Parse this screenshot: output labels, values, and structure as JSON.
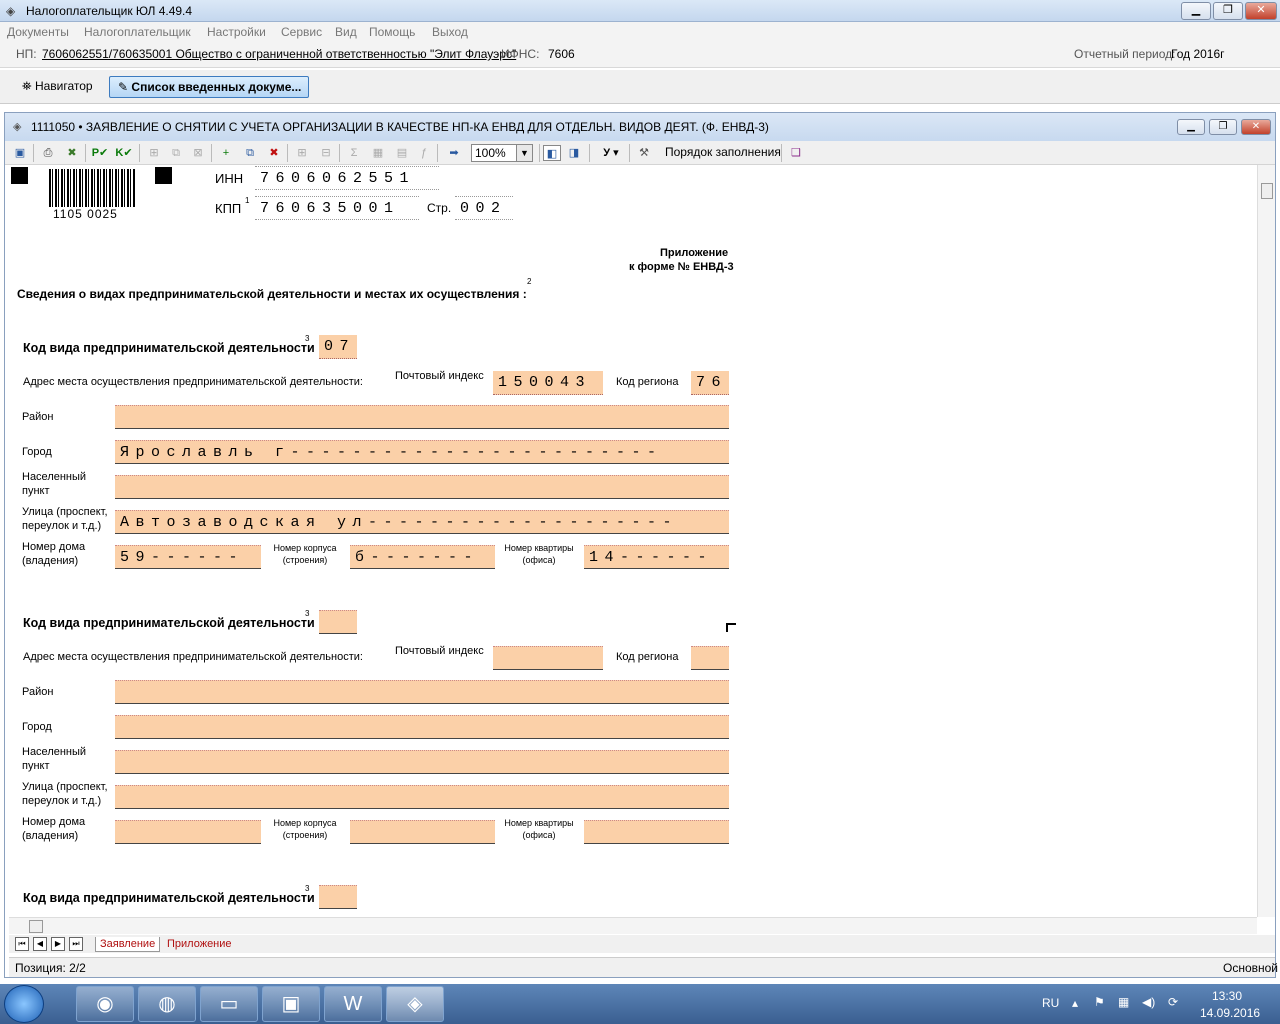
{
  "window": {
    "title": "Налогоплательщик ЮЛ 4.49.4"
  },
  "menu": [
    "Документы",
    "Налогоплательщик",
    "Настройки",
    "Сервис",
    "Вид",
    "Помощь",
    "Выход"
  ],
  "npbar": {
    "np_label": "НП:",
    "np_value": "7606062551/760635001 Общество с ограниченной ответственностью \"Элит Флауэрс\"",
    "ifns_label": "ИФНС:",
    "ifns_value": "7606",
    "period_label": "Отчетный период:",
    "period_value": "Год  2016г"
  },
  "navbar": {
    "navigator": "Навигатор",
    "list": "Список введенных докуме..."
  },
  "child": {
    "title": "1111050 • ЗАЯВЛЕНИЕ О СНЯТИИ С УЧЕТА ОРГАНИЗАЦИИ В КАЧЕСТВЕ НП-КА ЕНВД ДЛЯ ОТДЕЛЬН. ВИДОВ ДЕЯТ. (Ф. ЕНВД-3)"
  },
  "toolbar": {
    "zoom": "100%",
    "y_label": "У",
    "order": "Порядок заполнения"
  },
  "form": {
    "barcode": "1105 0025",
    "inn_label": "ИНН",
    "inn": "7606062551",
    "kpp_label": "КПП",
    "kpp_sup": "1",
    "kpp": "760635001",
    "page_label": "Стр.",
    "page": "002",
    "appendix1": "Приложение",
    "appendix2": "к форме № ЕНВД-3",
    "heading": "Сведения о видах предпринимательской деятельности и местах их осуществления :",
    "heading_sup": "2",
    "activity_label": "Код вида предпринимательской деятельности",
    "activity_sup": "3",
    "address_label": "Адрес места осуществления предпринимательской деятельности:",
    "postal_label": "Почтовый индекс",
    "region_label": "Код региона",
    "district_label": "Район",
    "city_label": "Город",
    "locality_label_1": "Населенный",
    "locality_label_2": "пункт",
    "street_label_1": "Улица (проспект,",
    "street_label_2": "переулок и т.д.)",
    "house_label_1": "Номер дома",
    "house_label_2": "(владения)",
    "building_label_1": "Номер корпуса",
    "building_label_2": "(строения)",
    "flat_label_1": "Номер квартиры",
    "flat_label_2": "(офиса)",
    "blocks": [
      {
        "activity": "07",
        "postal": "150043",
        "region": "76",
        "district": "",
        "city": "Ярославль г------------------------",
        "locality": "",
        "street": "Автозаводская ул--------------------",
        "house": "59------",
        "building": "б-------",
        "flat": "14------"
      },
      {
        "activity": "",
        "postal": "",
        "region": "",
        "district": "",
        "city": "",
        "locality": "",
        "street": "",
        "house": "",
        "building": "",
        "flat": ""
      },
      {
        "activity": ""
      }
    ]
  },
  "sheet_tabs": [
    "Заявление",
    "Приложение"
  ],
  "status": {
    "position": "Позиция: 2/2",
    "mode": "Основной"
  },
  "tray": {
    "lang": "RU",
    "time": "13:30",
    "date": "14.09.2016"
  }
}
